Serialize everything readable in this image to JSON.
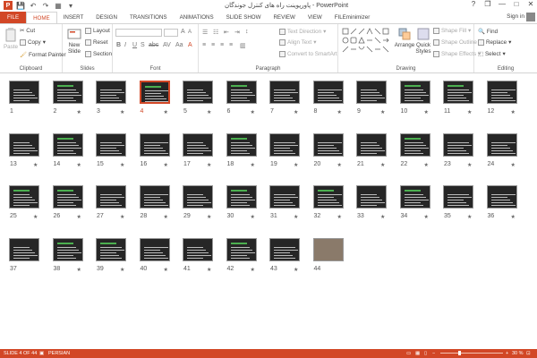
{
  "window": {
    "title": "پاورپوینت راه های کنترل جوندگان - PowerPoint",
    "help": "?",
    "restore": "❐",
    "minimize": "—",
    "maximize": "□",
    "close": "✕",
    "signin": "Sign in"
  },
  "qat": {
    "save": "💾",
    "undo": "↶",
    "redo": "↷",
    "present": "▦",
    "more": "▾"
  },
  "tabs": [
    "FILE",
    "HOME",
    "INSERT",
    "DESIGN",
    "TRANSITIONS",
    "ANIMATIONS",
    "SLIDE SHOW",
    "REVIEW",
    "VIEW",
    "FILEminimizer"
  ],
  "active_tab": "HOME",
  "ribbon": {
    "clipboard": {
      "paste": "Paste",
      "cut": "Cut",
      "copy": "Copy",
      "format_painter": "Format Painter",
      "label": "Clipboard"
    },
    "slides": {
      "new_slide": "New Slide",
      "layout": "Layout",
      "reset": "Reset",
      "section": "Section",
      "label": "Slides"
    },
    "font": {
      "label": "Font"
    },
    "paragraph": {
      "text_direction": "Text Direction",
      "align_text": "Align Text",
      "convert": "Convert to SmartArt",
      "label": "Paragraph"
    },
    "drawing": {
      "arrange": "Arrange",
      "quick_styles": "Quick Styles",
      "shape_fill": "Shape Fill",
      "shape_outline": "Shape Outline",
      "shape_effects": "Shape Effects",
      "label": "Drawing"
    },
    "editing": {
      "find": "Find",
      "replace": "Replace",
      "select": "Select",
      "label": "Editing"
    }
  },
  "slides": [
    {
      "n": "1",
      "star": ""
    },
    {
      "n": "2",
      "star": "★"
    },
    {
      "n": "3",
      "star": "★"
    },
    {
      "n": "4",
      "star": "★"
    },
    {
      "n": "5",
      "star": "★"
    },
    {
      "n": "6",
      "star": "★"
    },
    {
      "n": "7",
      "star": "★"
    },
    {
      "n": "8",
      "star": "★"
    },
    {
      "n": "9",
      "star": "★"
    },
    {
      "n": "10",
      "star": "★"
    },
    {
      "n": "11",
      "star": "★"
    },
    {
      "n": "12",
      "star": "★"
    },
    {
      "n": "13",
      "star": "★"
    },
    {
      "n": "14",
      "star": "★"
    },
    {
      "n": "15",
      "star": "★"
    },
    {
      "n": "16",
      "star": "★"
    },
    {
      "n": "17",
      "star": "★"
    },
    {
      "n": "18",
      "star": "★"
    },
    {
      "n": "19",
      "star": "★"
    },
    {
      "n": "20",
      "star": "★"
    },
    {
      "n": "21",
      "star": "★"
    },
    {
      "n": "22",
      "star": "★"
    },
    {
      "n": "23",
      "star": "★"
    },
    {
      "n": "24",
      "star": "★"
    },
    {
      "n": "25",
      "star": "★"
    },
    {
      "n": "26",
      "star": "★"
    },
    {
      "n": "27",
      "star": "★"
    },
    {
      "n": "28",
      "star": "★"
    },
    {
      "n": "29",
      "star": "★"
    },
    {
      "n": "30",
      "star": "★"
    },
    {
      "n": "31",
      "star": "★"
    },
    {
      "n": "32",
      "star": "★"
    },
    {
      "n": "33",
      "star": "★"
    },
    {
      "n": "34",
      "star": "★"
    },
    {
      "n": "35",
      "star": "★"
    },
    {
      "n": "36",
      "star": "★"
    },
    {
      "n": "37",
      "star": ""
    },
    {
      "n": "38",
      "star": "★"
    },
    {
      "n": "39",
      "star": "★"
    },
    {
      "n": "40",
      "star": "★"
    },
    {
      "n": "41",
      "star": "★"
    },
    {
      "n": "42",
      "star": "★"
    },
    {
      "n": "43",
      "star": "★"
    },
    {
      "n": "44",
      "star": ""
    }
  ],
  "selected_slide": "4",
  "status": {
    "slide_info": "SLIDE 4 OF 44",
    "language": "PERSIAN",
    "zoom": "30 %",
    "zoom_level": 0.3
  },
  "colors": {
    "accent": "#d24726"
  }
}
